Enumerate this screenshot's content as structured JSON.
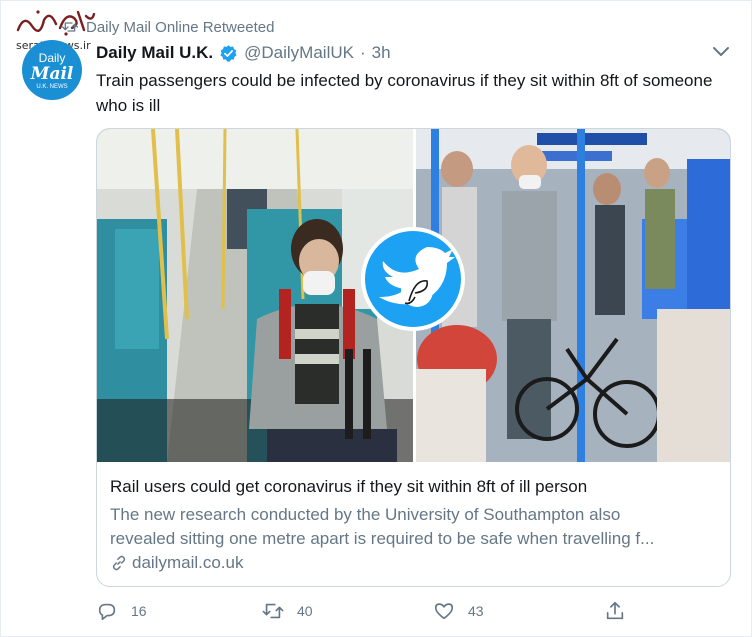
{
  "watermark": {
    "site": "serathnews.ir"
  },
  "retweet": {
    "label": "Daily Mail Online Retweeted"
  },
  "author": {
    "avatar_line1": "Daily",
    "avatar_line2": "Mail",
    "avatar_line3": "U.K. NEWS",
    "name": "Daily Mail U.K.",
    "handle": "@DailyMailUK",
    "separator": "·",
    "time": "3h"
  },
  "tweet": {
    "text": "Train passengers could be infected by coronavirus if they sit within 8ft of someone who is ill"
  },
  "card": {
    "title": "Rail users could get coronavirus if they sit within 8ft of ill person",
    "desc_line1": "The new research conducted by the University of Southampton also",
    "desc_line2": "revealed sitting one metre apart is required to be safe when travelling f...",
    "domain": "dailymail.co.uk"
  },
  "actions": {
    "replies": "16",
    "retweets": "40",
    "likes": "43"
  },
  "colors": {
    "accent": "#1da1f2",
    "secondary_text": "#657786",
    "border": "#ccd6dd",
    "avatar_bg": "#1a8fd4"
  }
}
